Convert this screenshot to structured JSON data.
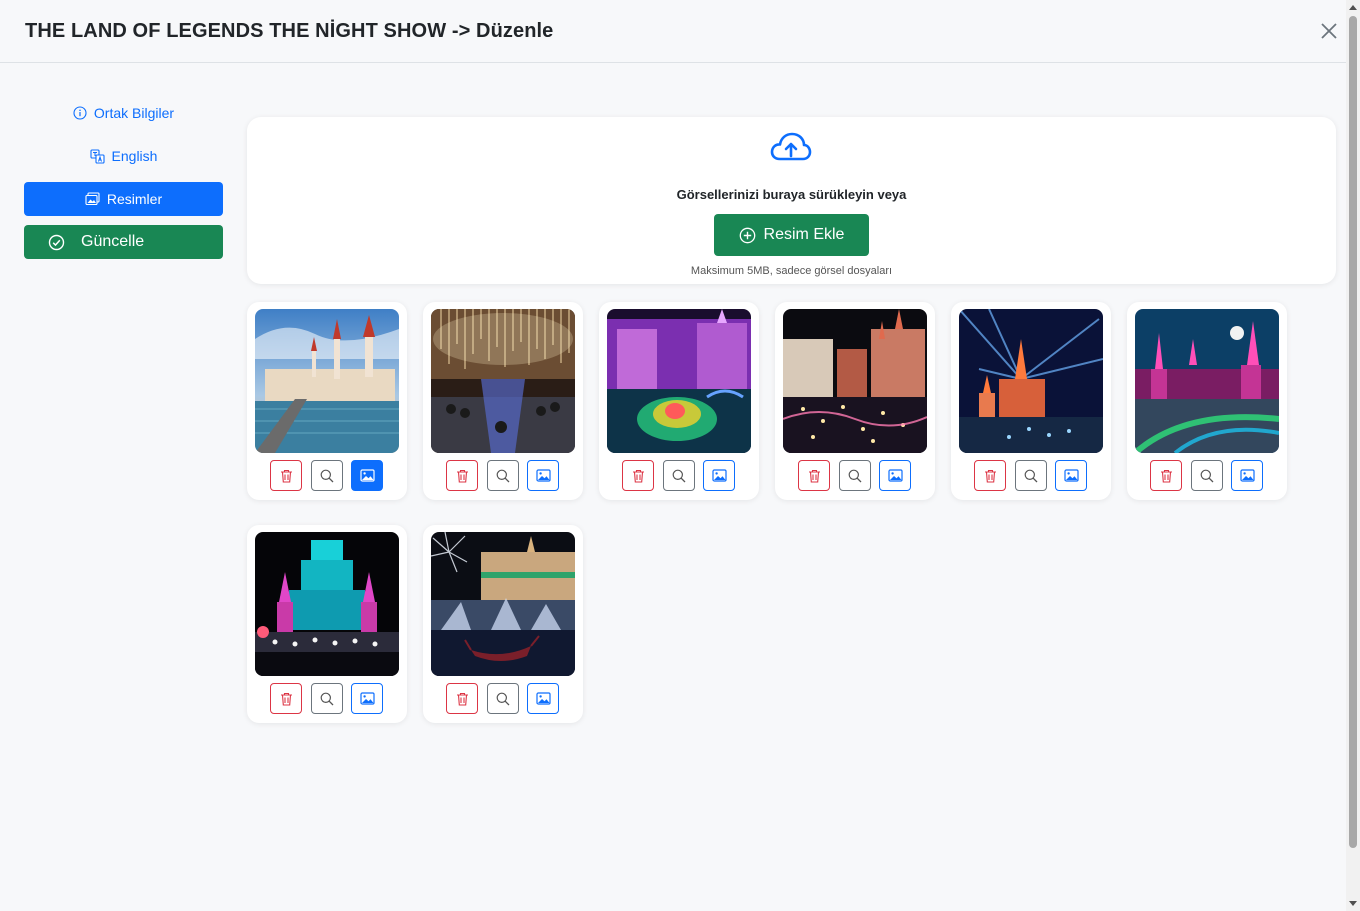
{
  "header": {
    "title": "THE LAND OF LEGENDS THE NİGHT SHOW -> Düzenle"
  },
  "sidebar": {
    "items": [
      {
        "label": "Ortak Bilgiler",
        "icon": "info-circle-icon",
        "active": false
      },
      {
        "label": "English",
        "icon": "translate-icon",
        "active": false
      },
      {
        "label": "Resimler",
        "icon": "images-icon",
        "active": true
      }
    ],
    "update_label": "Güncelle"
  },
  "upload": {
    "prompt": "Görsellerinizi buraya sürükleyin veya",
    "add_label": "Resim Ekle",
    "hint": "Maksimum 5MB, sadece görsel dosyaları"
  },
  "gallery": {
    "images": [
      {
        "scene": "castle-waterfront-day",
        "is_cover": true
      },
      {
        "scene": "light-curtain-crowd",
        "is_cover": false
      },
      {
        "scene": "purple-boat-night",
        "is_cover": false
      },
      {
        "scene": "castle-lights-night",
        "is_cover": false
      },
      {
        "scene": "castle-laser-show",
        "is_cover": false
      },
      {
        "scene": "pink-castle-moon",
        "is_cover": false
      },
      {
        "scene": "cyan-castle-show",
        "is_cover": false
      },
      {
        "scene": "fountain-gondola-fireworks",
        "is_cover": false
      }
    ]
  },
  "colors": {
    "primary": "#0d6efd",
    "success": "#198754",
    "danger": "#dc3545",
    "secondary": "#6c757d"
  }
}
